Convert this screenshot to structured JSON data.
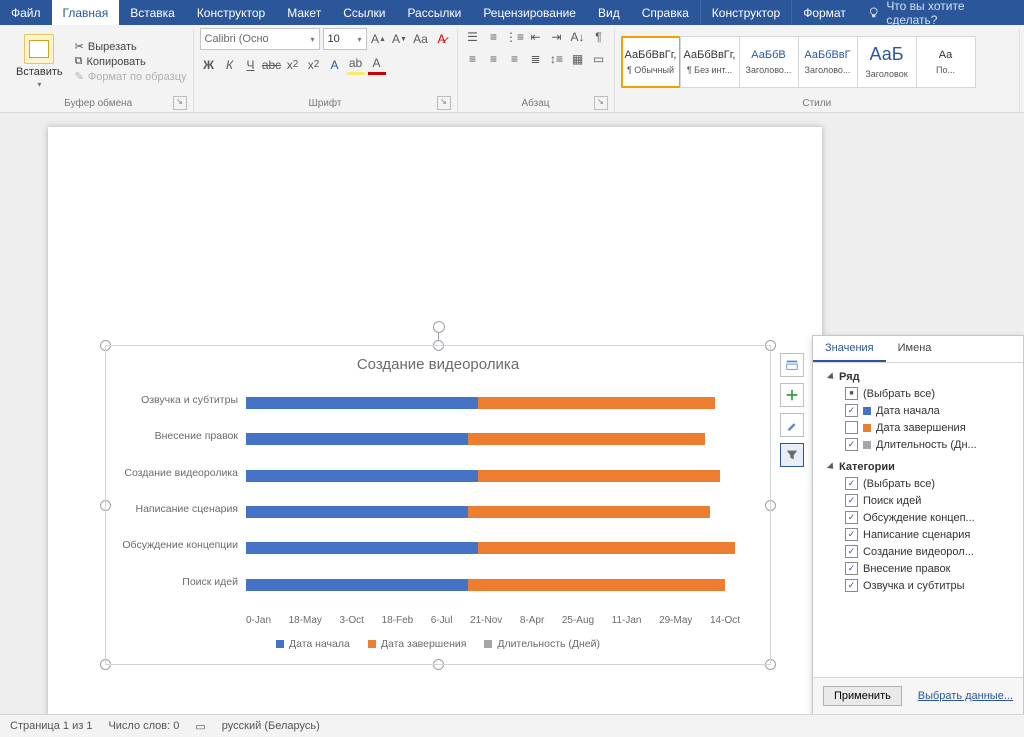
{
  "tabs": {
    "file": "Файл",
    "home": "Главная",
    "insert": "Вставка",
    "design": "Конструктор",
    "layout": "Макет",
    "references": "Ссылки",
    "mailings": "Рассылки",
    "review": "Рецензирование",
    "view": "Вид",
    "help": "Справка",
    "ctx_design": "Конструктор",
    "ctx_format": "Формат",
    "tellme": "Что вы хотите сделать?"
  },
  "ribbon": {
    "clipboard": {
      "label": "Буфер обмена",
      "paste": "Вставить",
      "cut": "Вырезать",
      "copy": "Копировать",
      "fmtpainter": "Формат по образцу"
    },
    "font": {
      "label": "Шрифт",
      "family": "Calibri (Осно",
      "size": "10"
    },
    "paragraph": {
      "label": "Абзац"
    },
    "styles": {
      "label": "Стили",
      "sample": "АаБбВвГг,",
      "big": "АаБ",
      "s1": "¶ Обычный",
      "s2": "¶ Без инт...",
      "s3": "Заголово...",
      "s4": "Заголово...",
      "s5": "Заголовок",
      "s6": "По..."
    }
  },
  "smart": {
    "layout": "layout",
    "plus": "plus",
    "brush": "brush",
    "filter": "filter"
  },
  "flyout": {
    "tab_values": "Значения",
    "tab_names": "Имена",
    "series_header": "Ряд",
    "series": {
      "all": "(Выбрать все)",
      "s1": "Дата начала",
      "s2": "Дата завершения",
      "s3": "Длительность (Дн..."
    },
    "cats_header": "Категории",
    "cats": {
      "all": "(Выбрать все)",
      "c1": "Поиск идей",
      "c2": "Обсуждение концеп...",
      "c3": "Написание сценария",
      "c4": "Создание видеорол...",
      "c5": "Внесение правок",
      "c6": "Озвучка и субтитры"
    },
    "apply": "Применить",
    "select_data": "Выбрать данные..."
  },
  "status": {
    "page": "Страница 1 из 1",
    "words": "Число слов: 0",
    "lang": "русский (Беларусь)"
  },
  "chart_data": {
    "type": "bar",
    "orientation": "horizontal",
    "title": "Создание видеоролика",
    "categories": [
      "Озвучка и субтитры",
      "Внесение правок",
      "Создание видеоролика",
      "Написание сценария",
      "Обсуждение концепции",
      "Поиск идей"
    ],
    "series": [
      {
        "name": "Дата начала",
        "color": "#4472c4",
        "values": [
          0.47,
          0.45,
          0.47,
          0.45,
          0.47,
          0.45
        ]
      },
      {
        "name": "Дата завершения",
        "color": "#ed7d31",
        "values": [
          0.48,
          0.48,
          0.49,
          0.49,
          0.52,
          0.52
        ]
      }
    ],
    "x_ticks": [
      "0-Jan",
      "18-May",
      "3-Oct",
      "18-Feb",
      "6-Jul",
      "21-Nov",
      "8-Apr",
      "25-Aug",
      "11-Jan",
      "29-May",
      "14-Oct"
    ],
    "legend": [
      "Дата начала",
      "Дата завершения",
      "Длительность (Дней)"
    ]
  }
}
